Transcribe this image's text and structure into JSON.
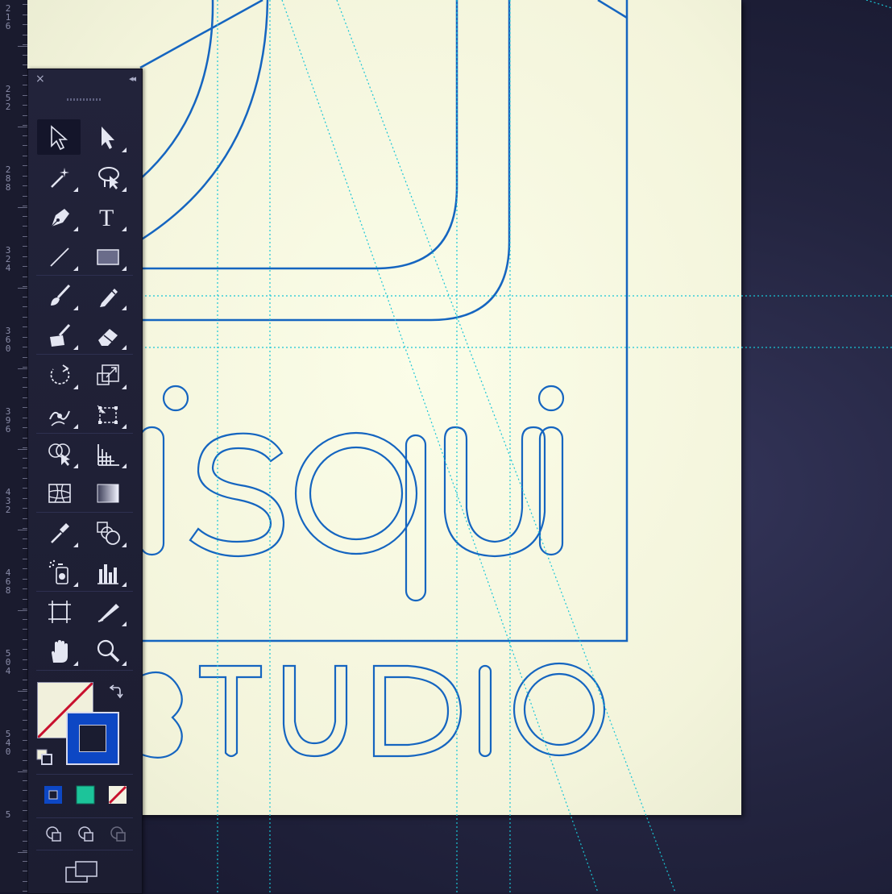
{
  "ruler": {
    "labels": [
      "2\n1\n6",
      "2\n5\n2",
      "2\n8\n8",
      "3\n2\n4",
      "3\n6\n0",
      "3\n9\n6",
      "4\n3\n2",
      "4\n6\n8",
      "5\n0\n4",
      "5\n4\n0",
      "5"
    ]
  },
  "artwork": {
    "wordmark": "isqui",
    "tagline": "STUDIO",
    "stroke_color": "#1565c0",
    "guide_color": "#19c6d6",
    "artboard_color": "#f7f8e2"
  },
  "tools_panel": {
    "close_glyph": "×",
    "collapse_glyph": "◂◂",
    "tools": [
      {
        "id": "selection",
        "icon": "selection-arrow-icon"
      },
      {
        "id": "direct-selection",
        "icon": "direct-selection-arrow-icon"
      },
      {
        "id": "magic-wand",
        "icon": "magic-wand-icon"
      },
      {
        "id": "lasso",
        "icon": "lasso-icon"
      },
      {
        "id": "pen",
        "icon": "pen-nib-icon"
      },
      {
        "id": "type",
        "icon": "type-icon",
        "glyph": "T"
      },
      {
        "id": "line-segment",
        "icon": "line-segment-icon"
      },
      {
        "id": "rectangle",
        "icon": "rectangle-icon"
      },
      {
        "id": "paintbrush",
        "icon": "paintbrush-icon"
      },
      {
        "id": "pencil",
        "icon": "pencil-icon"
      },
      {
        "id": "blob-brush",
        "icon": "blob-brush-icon"
      },
      {
        "id": "eraser",
        "icon": "eraser-icon"
      },
      {
        "id": "rotate",
        "icon": "rotate-icon"
      },
      {
        "id": "scale",
        "icon": "scale-icon"
      },
      {
        "id": "warp",
        "icon": "warp-icon"
      },
      {
        "id": "free-transform",
        "icon": "free-transform-icon"
      },
      {
        "id": "shape-builder",
        "icon": "shape-builder-icon"
      },
      {
        "id": "perspective-grid",
        "icon": "perspective-grid-icon"
      },
      {
        "id": "mesh",
        "icon": "mesh-icon"
      },
      {
        "id": "gradient",
        "icon": "gradient-icon"
      },
      {
        "id": "eyedropper",
        "icon": "eyedropper-icon"
      },
      {
        "id": "blend",
        "icon": "blend-icon"
      },
      {
        "id": "symbol-sprayer",
        "icon": "symbol-sprayer-icon"
      },
      {
        "id": "column-graph",
        "icon": "column-graph-icon"
      },
      {
        "id": "artboard",
        "icon": "artboard-icon"
      },
      {
        "id": "slice",
        "icon": "slice-icon"
      },
      {
        "id": "hand",
        "icon": "hand-icon"
      },
      {
        "id": "zoom",
        "icon": "zoom-icon"
      }
    ],
    "fill_color": "#f1f0dc",
    "fill_state": "none",
    "stroke_color": "#0d47c4",
    "color_modes": [
      {
        "id": "color",
        "icon": "color-mode-icon",
        "color": "#0d47c4"
      },
      {
        "id": "gradient",
        "icon": "gradient-mode-icon",
        "color": "#1cc49a"
      },
      {
        "id": "none",
        "icon": "none-mode-icon",
        "color": "#c8102e"
      }
    ],
    "draw_modes": [
      "draw-normal-icon",
      "draw-behind-icon",
      "draw-inside-icon"
    ],
    "screen_mode_icon": "screen-mode-icon"
  }
}
